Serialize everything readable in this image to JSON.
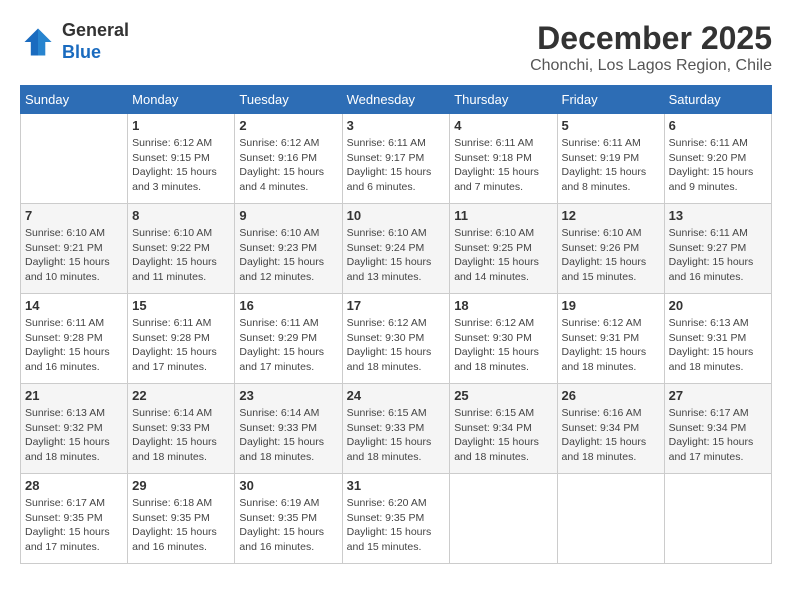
{
  "logo": {
    "general": "General",
    "blue": "Blue"
  },
  "title": "December 2025",
  "location": "Chonchi, Los Lagos Region, Chile",
  "weekdays": [
    "Sunday",
    "Monday",
    "Tuesday",
    "Wednesday",
    "Thursday",
    "Friday",
    "Saturday"
  ],
  "weeks": [
    [
      {
        "day": "",
        "sunrise": "",
        "sunset": "",
        "daylight": ""
      },
      {
        "day": "1",
        "sunrise": "Sunrise: 6:12 AM",
        "sunset": "Sunset: 9:15 PM",
        "daylight": "Daylight: 15 hours and 3 minutes."
      },
      {
        "day": "2",
        "sunrise": "Sunrise: 6:12 AM",
        "sunset": "Sunset: 9:16 PM",
        "daylight": "Daylight: 15 hours and 4 minutes."
      },
      {
        "day": "3",
        "sunrise": "Sunrise: 6:11 AM",
        "sunset": "Sunset: 9:17 PM",
        "daylight": "Daylight: 15 hours and 6 minutes."
      },
      {
        "day": "4",
        "sunrise": "Sunrise: 6:11 AM",
        "sunset": "Sunset: 9:18 PM",
        "daylight": "Daylight: 15 hours and 7 minutes."
      },
      {
        "day": "5",
        "sunrise": "Sunrise: 6:11 AM",
        "sunset": "Sunset: 9:19 PM",
        "daylight": "Daylight: 15 hours and 8 minutes."
      },
      {
        "day": "6",
        "sunrise": "Sunrise: 6:11 AM",
        "sunset": "Sunset: 9:20 PM",
        "daylight": "Daylight: 15 hours and 9 minutes."
      }
    ],
    [
      {
        "day": "7",
        "sunrise": "Sunrise: 6:10 AM",
        "sunset": "Sunset: 9:21 PM",
        "daylight": "Daylight: 15 hours and 10 minutes."
      },
      {
        "day": "8",
        "sunrise": "Sunrise: 6:10 AM",
        "sunset": "Sunset: 9:22 PM",
        "daylight": "Daylight: 15 hours and 11 minutes."
      },
      {
        "day": "9",
        "sunrise": "Sunrise: 6:10 AM",
        "sunset": "Sunset: 9:23 PM",
        "daylight": "Daylight: 15 hours and 12 minutes."
      },
      {
        "day": "10",
        "sunrise": "Sunrise: 6:10 AM",
        "sunset": "Sunset: 9:24 PM",
        "daylight": "Daylight: 15 hours and 13 minutes."
      },
      {
        "day": "11",
        "sunrise": "Sunrise: 6:10 AM",
        "sunset": "Sunset: 9:25 PM",
        "daylight": "Daylight: 15 hours and 14 minutes."
      },
      {
        "day": "12",
        "sunrise": "Sunrise: 6:10 AM",
        "sunset": "Sunset: 9:26 PM",
        "daylight": "Daylight: 15 hours and 15 minutes."
      },
      {
        "day": "13",
        "sunrise": "Sunrise: 6:11 AM",
        "sunset": "Sunset: 9:27 PM",
        "daylight": "Daylight: 15 hours and 16 minutes."
      }
    ],
    [
      {
        "day": "14",
        "sunrise": "Sunrise: 6:11 AM",
        "sunset": "Sunset: 9:28 PM",
        "daylight": "Daylight: 15 hours and 16 minutes."
      },
      {
        "day": "15",
        "sunrise": "Sunrise: 6:11 AM",
        "sunset": "Sunset: 9:28 PM",
        "daylight": "Daylight: 15 hours and 17 minutes."
      },
      {
        "day": "16",
        "sunrise": "Sunrise: 6:11 AM",
        "sunset": "Sunset: 9:29 PM",
        "daylight": "Daylight: 15 hours and 17 minutes."
      },
      {
        "day": "17",
        "sunrise": "Sunrise: 6:12 AM",
        "sunset": "Sunset: 9:30 PM",
        "daylight": "Daylight: 15 hours and 18 minutes."
      },
      {
        "day": "18",
        "sunrise": "Sunrise: 6:12 AM",
        "sunset": "Sunset: 9:30 PM",
        "daylight": "Daylight: 15 hours and 18 minutes."
      },
      {
        "day": "19",
        "sunrise": "Sunrise: 6:12 AM",
        "sunset": "Sunset: 9:31 PM",
        "daylight": "Daylight: 15 hours and 18 minutes."
      },
      {
        "day": "20",
        "sunrise": "Sunrise: 6:13 AM",
        "sunset": "Sunset: 9:31 PM",
        "daylight": "Daylight: 15 hours and 18 minutes."
      }
    ],
    [
      {
        "day": "21",
        "sunrise": "Sunrise: 6:13 AM",
        "sunset": "Sunset: 9:32 PM",
        "daylight": "Daylight: 15 hours and 18 minutes."
      },
      {
        "day": "22",
        "sunrise": "Sunrise: 6:14 AM",
        "sunset": "Sunset: 9:33 PM",
        "daylight": "Daylight: 15 hours and 18 minutes."
      },
      {
        "day": "23",
        "sunrise": "Sunrise: 6:14 AM",
        "sunset": "Sunset: 9:33 PM",
        "daylight": "Daylight: 15 hours and 18 minutes."
      },
      {
        "day": "24",
        "sunrise": "Sunrise: 6:15 AM",
        "sunset": "Sunset: 9:33 PM",
        "daylight": "Daylight: 15 hours and 18 minutes."
      },
      {
        "day": "25",
        "sunrise": "Sunrise: 6:15 AM",
        "sunset": "Sunset: 9:34 PM",
        "daylight": "Daylight: 15 hours and 18 minutes."
      },
      {
        "day": "26",
        "sunrise": "Sunrise: 6:16 AM",
        "sunset": "Sunset: 9:34 PM",
        "daylight": "Daylight: 15 hours and 18 minutes."
      },
      {
        "day": "27",
        "sunrise": "Sunrise: 6:17 AM",
        "sunset": "Sunset: 9:34 PM",
        "daylight": "Daylight: 15 hours and 17 minutes."
      }
    ],
    [
      {
        "day": "28",
        "sunrise": "Sunrise: 6:17 AM",
        "sunset": "Sunset: 9:35 PM",
        "daylight": "Daylight: 15 hours and 17 minutes."
      },
      {
        "day": "29",
        "sunrise": "Sunrise: 6:18 AM",
        "sunset": "Sunset: 9:35 PM",
        "daylight": "Daylight: 15 hours and 16 minutes."
      },
      {
        "day": "30",
        "sunrise": "Sunrise: 6:19 AM",
        "sunset": "Sunset: 9:35 PM",
        "daylight": "Daylight: 15 hours and 16 minutes."
      },
      {
        "day": "31",
        "sunrise": "Sunrise: 6:20 AM",
        "sunset": "Sunset: 9:35 PM",
        "daylight": "Daylight: 15 hours and 15 minutes."
      },
      {
        "day": "",
        "sunrise": "",
        "sunset": "",
        "daylight": ""
      },
      {
        "day": "",
        "sunrise": "",
        "sunset": "",
        "daylight": ""
      },
      {
        "day": "",
        "sunrise": "",
        "sunset": "",
        "daylight": ""
      }
    ]
  ]
}
